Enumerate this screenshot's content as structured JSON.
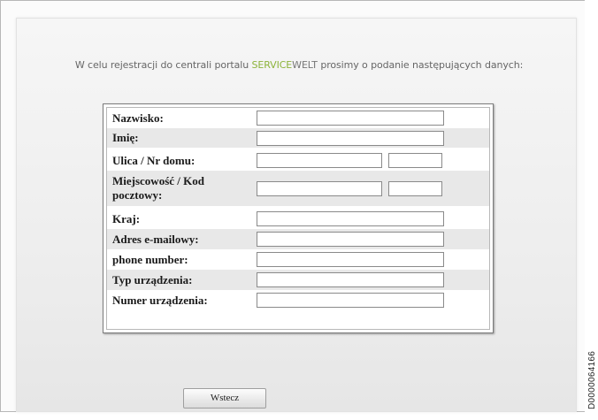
{
  "intro": {
    "before": "W celu rejestracji do centrali portalu ",
    "brand_part1": "SERVICE",
    "brand_part2": "WELT",
    "after": " prosimy o podanie następujących danych:"
  },
  "form": {
    "rows": [
      {
        "label": "Nazwisko:",
        "value": ""
      },
      {
        "label": "Imię:",
        "value": ""
      },
      {
        "label": "Ulica / Nr domu:",
        "value": "",
        "value2": ""
      },
      {
        "label": "Miejscowość / Kod pocztowy:",
        "value": "",
        "value2": ""
      },
      {
        "label": "Kraj:",
        "value": ""
      },
      {
        "label": "Adres e-mailowy:",
        "value": ""
      },
      {
        "label": "phone number:",
        "value": ""
      },
      {
        "label": "Typ urządzenia:",
        "value": ""
      },
      {
        "label": "Numer urządzenia:",
        "value": ""
      }
    ]
  },
  "back_button_label": "Wstecz",
  "document_id": "D0000064166",
  "colors": {
    "brand_green": "#8cb33a",
    "row_alt": "#e8e8e8",
    "panel_bg": "#efefef"
  }
}
